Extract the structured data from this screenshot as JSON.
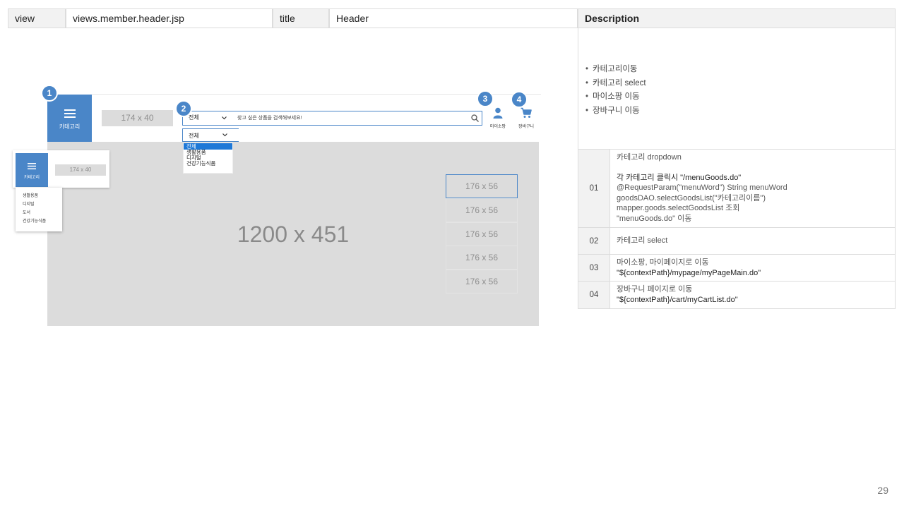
{
  "header": {
    "view_label": "view",
    "view_value": "views.member.header.jsp",
    "title_label": "title",
    "title_value": "Header",
    "description_label": "Description"
  },
  "description": {
    "bullets": [
      "카테고리이동",
      "카테고리 select",
      "마이소팡 이동",
      "장바구니 이동"
    ],
    "rows": [
      {
        "num": "01",
        "lines": [
          "카테고리 dropdown",
          "",
          "각 카테고리 클릭시 \"/menuGoods.do\"",
          "@RequestParam(\"menuWord\") String menuWord",
          "goodsDAO.selectGoodsList(\"카테고리이름\")",
          "mapper.goods.selectGoodsList 조회",
          "\"menuGoods.do\" 이동"
        ]
      },
      {
        "num": "02",
        "lines": [
          "카테고리 select"
        ]
      },
      {
        "num": "03",
        "lines": [
          "마이소팡, 마이페이지로 이동",
          "\"${contextPath}/mypage/myPageMain.do\""
        ]
      },
      {
        "num": "04",
        "lines": [
          "장바구니 페이지로 이동",
          "\"${contextPath}/cart/myCartList.do\""
        ]
      }
    ]
  },
  "mockup": {
    "category_label": "카테고리",
    "logo_placeholder": "174 x 40",
    "search_select_value": "전체",
    "search_placeholder": "찾고 싶은 상품을 검색해보세요!",
    "dropdown_value": "전체",
    "dropdown_options": [
      "전체",
      "생활용품",
      "디지털",
      "건강기능식품"
    ],
    "mypage_label": "마이소팡",
    "cart_label": "장바구니",
    "banner_placeholder": "1200 x 451",
    "side_banners": [
      "176 x 56",
      "176 x 56",
      "176 x 56",
      "176 x 56",
      "176 x 56"
    ],
    "small_category_label": "카테고리",
    "small_logo_placeholder": "174 x 40",
    "small_menu_items": [
      "생활용품",
      "디지털",
      "도서",
      "건강기능식품"
    ],
    "badges": [
      "1",
      "2",
      "3",
      "4"
    ]
  },
  "colors": {
    "accent": "#4a86c8",
    "placeholder_gray": "#dcdcdc",
    "selected_option": "#1e78d7"
  },
  "page_number": "29"
}
